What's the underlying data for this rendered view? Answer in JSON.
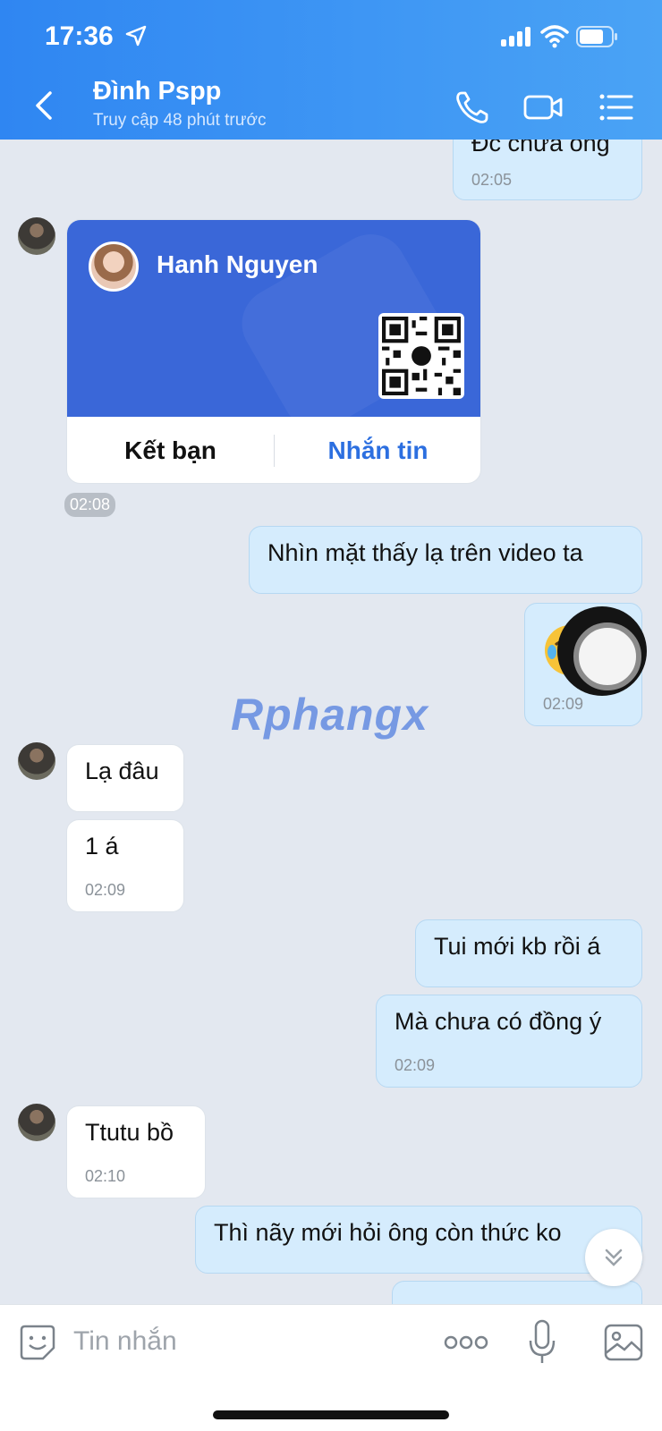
{
  "status_bar": {
    "time": "17:36"
  },
  "header": {
    "title": "Đình Pspp",
    "subtitle": "Truy cập 48 phút trước"
  },
  "messages": [
    {
      "id": "m0",
      "side": "mine",
      "text": "Đc chưa ông",
      "time": "02:05"
    },
    {
      "id": "m1",
      "side": "theirs",
      "type": "contact_card",
      "card": {
        "name": "Hanh Nguyen",
        "add_friend": "Kết bạn",
        "message": "Nhắn tin"
      },
      "time": "02:08"
    },
    {
      "id": "m2",
      "side": "mine",
      "text": "Nhìn mặt thấy lạ trên video ta"
    },
    {
      "id": "m3",
      "side": "mine",
      "type": "emoji",
      "time": "02:09"
    },
    {
      "id": "m4",
      "side": "theirs",
      "text": "Lạ đâu"
    },
    {
      "id": "m5",
      "side": "theirs",
      "text": "1 á",
      "time": "02:09"
    },
    {
      "id": "m6",
      "side": "mine",
      "text": "Tui mới kb rồi á"
    },
    {
      "id": "m7",
      "side": "mine",
      "text": "Mà chưa có đồng ý",
      "time": "02:09"
    },
    {
      "id": "m8",
      "side": "theirs",
      "text": "Ttutu bồ",
      "time": "02:10"
    },
    {
      "id": "m9",
      "side": "mine",
      "text": "Thì nãy mới hỏi ông còn thức ko"
    }
  ],
  "watermark": "Rphangx",
  "input": {
    "placeholder": "Tin nhắn"
  },
  "icons": {
    "back": "chevron-left-icon",
    "call": "phone-icon",
    "video": "video-camera-icon",
    "menu": "list-menu-icon",
    "emoji": "sticker-icon",
    "more": "more-dots-icon",
    "mic": "microphone-icon",
    "image": "image-icon"
  },
  "colors": {
    "header_start": "#2f86f2",
    "header_end": "#4aa3f5",
    "mine_bubble": "#d5ecfd",
    "accent": "#2c6fe0"
  }
}
